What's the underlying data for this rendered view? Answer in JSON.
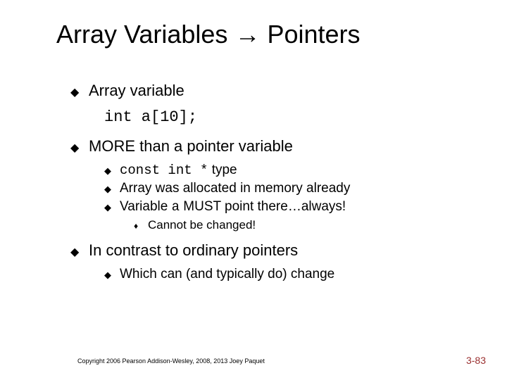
{
  "title_part1": "Array Variables ",
  "title_arrow": "→",
  "title_part2": " Pointers",
  "bullets": {
    "b1": "Array variable",
    "code": "int a[10];",
    "b2": "MORE than a pointer variable",
    "b2_sub1_code": "const int *",
    "b2_sub1_rest": " type",
    "b2_sub2": "Array was allocated in memory already",
    "b2_sub3_pre": "Variable ",
    "b2_sub3_code": "a",
    "b2_sub3_post": " MUST point there…always!",
    "b2_sub3_sub": "Cannot be changed!",
    "b3": "In contrast to ordinary pointers",
    "b3_sub1": "Which can (and typically do) change"
  },
  "footer": {
    "copyright": "Copyright 2006 Pearson Addison-Wesley, 2008, 2013 Joey Paquet",
    "pagenum": "3-83"
  }
}
